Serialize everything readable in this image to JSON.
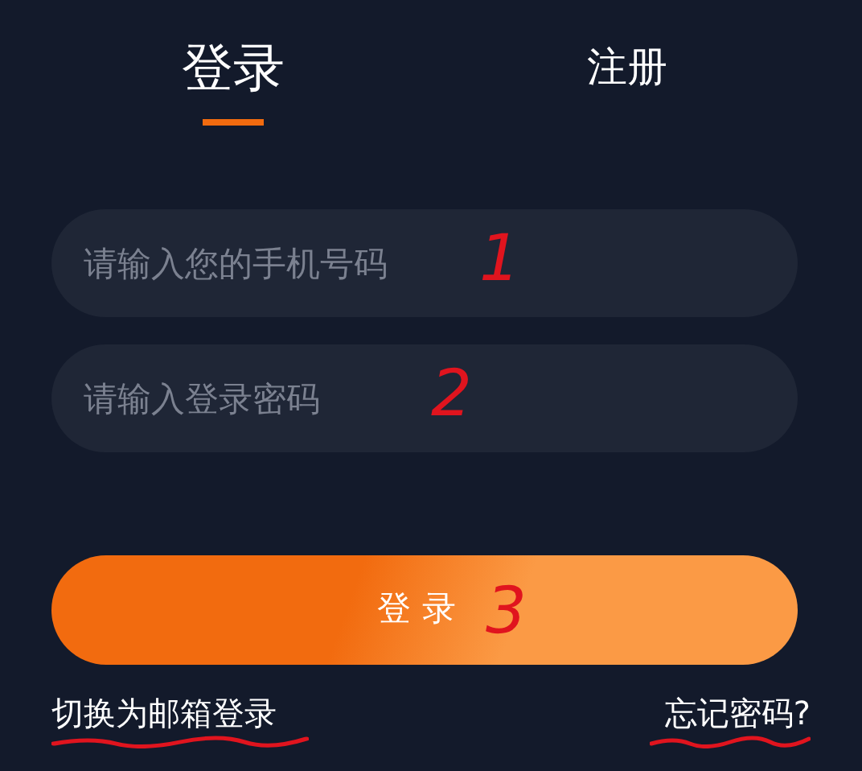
{
  "tabs": [
    {
      "label": "登录",
      "selected": true
    },
    {
      "label": "注册",
      "selected": false
    }
  ],
  "fields": [
    {
      "placeholder": "请输入您的手机号码",
      "annotation": "1"
    },
    {
      "placeholder": "请输入登录密码",
      "annotation": "2"
    }
  ],
  "login_button": {
    "label": "登 录",
    "annotation": "3"
  },
  "links": [
    {
      "label": "切换为邮箱登录",
      "underlined": true
    },
    {
      "label": "忘记密码?",
      "underlined": true
    }
  ]
}
